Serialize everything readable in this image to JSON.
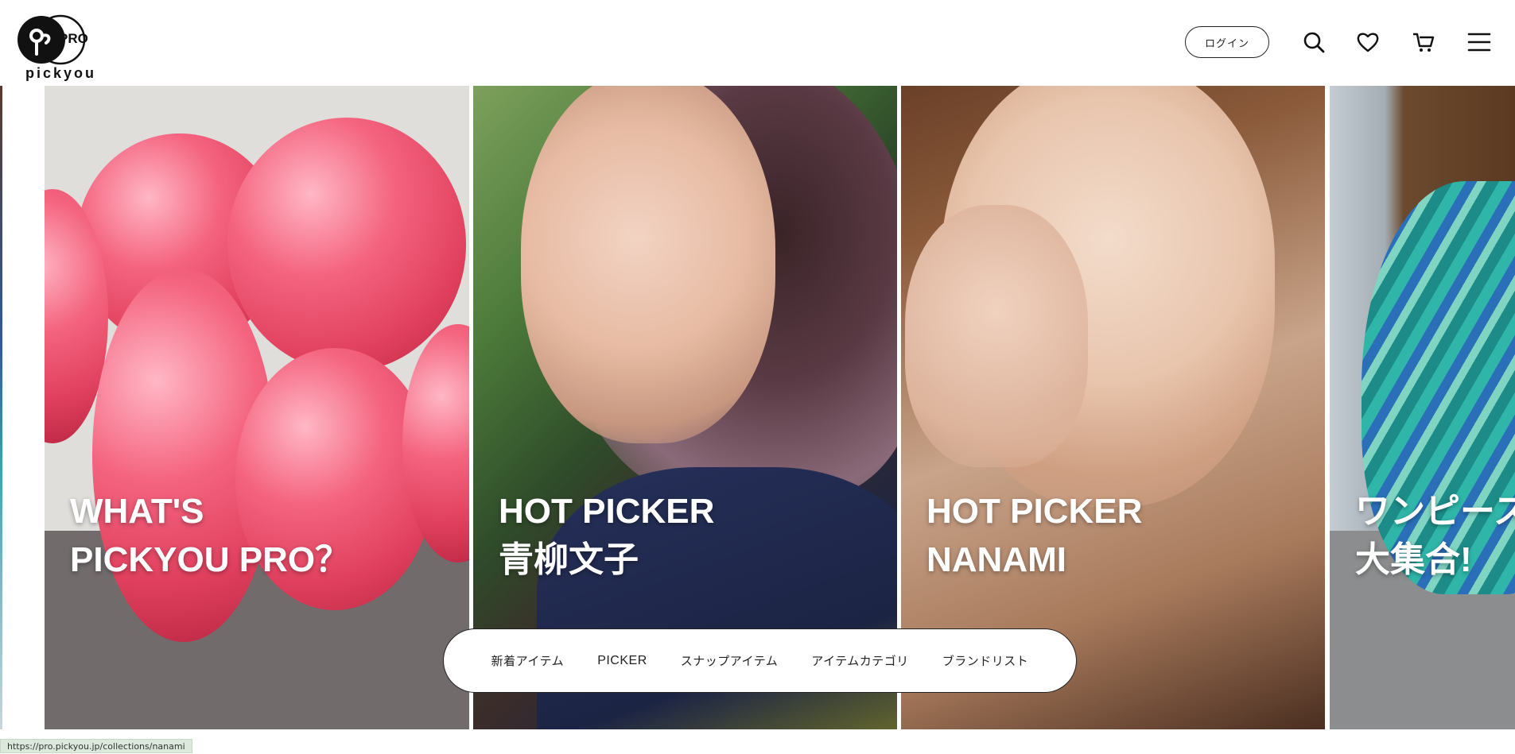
{
  "header": {
    "logo_badge": "PRO",
    "logo_wordmark": "pickyou",
    "login_label": "ログイン",
    "icons": [
      "search-icon",
      "heart-icon",
      "cart-icon",
      "menu-icon"
    ]
  },
  "slides": [
    {
      "line1": "WHAT'S",
      "line2": "PICKYOU PRO？"
    },
    {
      "line1": "HOT PICKER",
      "line2": "青柳文子"
    },
    {
      "line1": "HOT PICKER",
      "line2": "NANAMI"
    },
    {
      "line1": "ワンピース",
      "line2": "大集合!"
    }
  ],
  "category_nav": {
    "items": [
      "新着アイテム",
      "PICKER",
      "スナップアイテム",
      "アイテムカテゴリ",
      "ブランドリスト"
    ]
  },
  "status_bar": {
    "url": "https://pro.pickyou.jp/collections/nanami"
  }
}
